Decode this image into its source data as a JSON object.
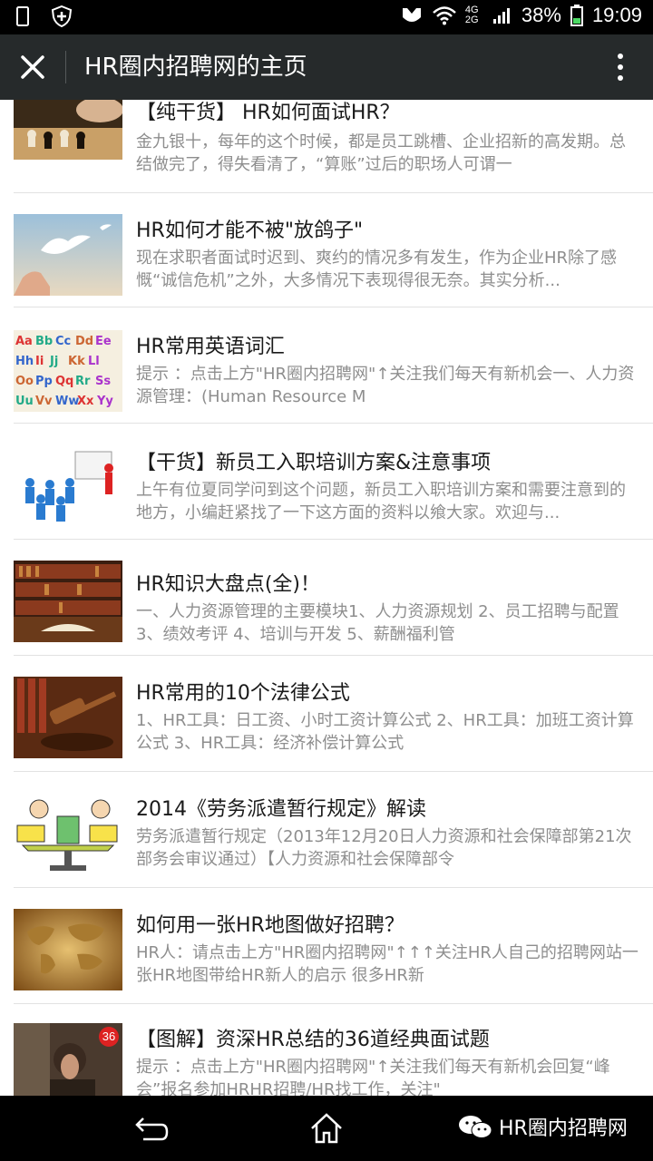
{
  "status_bar": {
    "network": "4G 2G",
    "battery_percent": "38%",
    "time": "19:09"
  },
  "header": {
    "title": "HR圈内招聘网的主页",
    "close_icon": "close-icon",
    "more_icon": "more-vertical-icon"
  },
  "articles": [
    {
      "title": "【纯干货】 HR如何面试HR？",
      "desc": "金九银十，每年的这个时候，都是员工跳槽、企业招新的高发期。总结做完了，得失看清了，“算账”过后的职场人可谓一",
      "thumb": "chess"
    },
    {
      "title": "HR如何才能不被\"放鸽子\"",
      "desc": "现在求职者面试时迟到、爽约的情况多有发生，作为企业HR除了感慨“诚信危机”之外，大多情况下表现得很无奈。其实分析...",
      "thumb": "dove"
    },
    {
      "title": "HR常用英语词汇",
      "desc": "提示 ：点击上方\"HR圈内招聘网\"↑关注我们每天有新机会一、人力资源管理：(Human Resource M",
      "thumb": "alphabet"
    },
    {
      "title": "【干货】新员工入职培训方案&注意事项",
      "desc": "上午有位夏同学问到这个问题，新员工入职培训方案和需要注意到的地方，小编赶紧找了一下这方面的资料以飨大家。欢迎与...",
      "thumb": "training"
    },
    {
      "title": "HR知识大盘点(全)！",
      "desc": "一、人力资源管理的主要模块1、人力资源规划 2、员工招聘与配置 3、绩效考评 4、培训与开发 5、薪酬福利管",
      "thumb": "books"
    },
    {
      "title": "HR常用的10个法律公式",
      "desc": "1、HR工具：日工资、小时工资计算公式 2、HR工具：加班工资计算公式 3、HR工具：经济补偿计算公式",
      "thumb": "gavel"
    },
    {
      "title": "2014《劳务派遣暂行规定》解读",
      "desc": "劳务派遣暂行规定（2013年12月20日人力资源和社会保障部第21次部务会审议通过）【人力资源和社会保障部令",
      "thumb": "cartoon"
    },
    {
      "title": "如何用一张HR地图做好招聘？",
      "desc": "HR人：请点击上方\"HR圈内招聘网\"↑↑↑关注HR人自己的招聘网站一张HR地图带给HR新人的启示 很多HR新",
      "thumb": "map"
    },
    {
      "title": "【图解】资深HR总结的36道经典面试题",
      "desc": "提示 ：点击上方\"HR圈内招聘网\"↑关注我们每天有新机会回复“峰会”报名参加HRHR招聘/HR找工作，关注\"",
      "thumb": "man",
      "badge": "36"
    }
  ],
  "watermark": {
    "text": "HR圈内招聘网"
  },
  "colors": {
    "title_bar": "#262a2b",
    "status_bar": "#000000",
    "nav_bar": "#000000",
    "title_text": "#1a1a1a",
    "desc_text": "#8e8e8e",
    "separator": "#e2e2e2"
  }
}
